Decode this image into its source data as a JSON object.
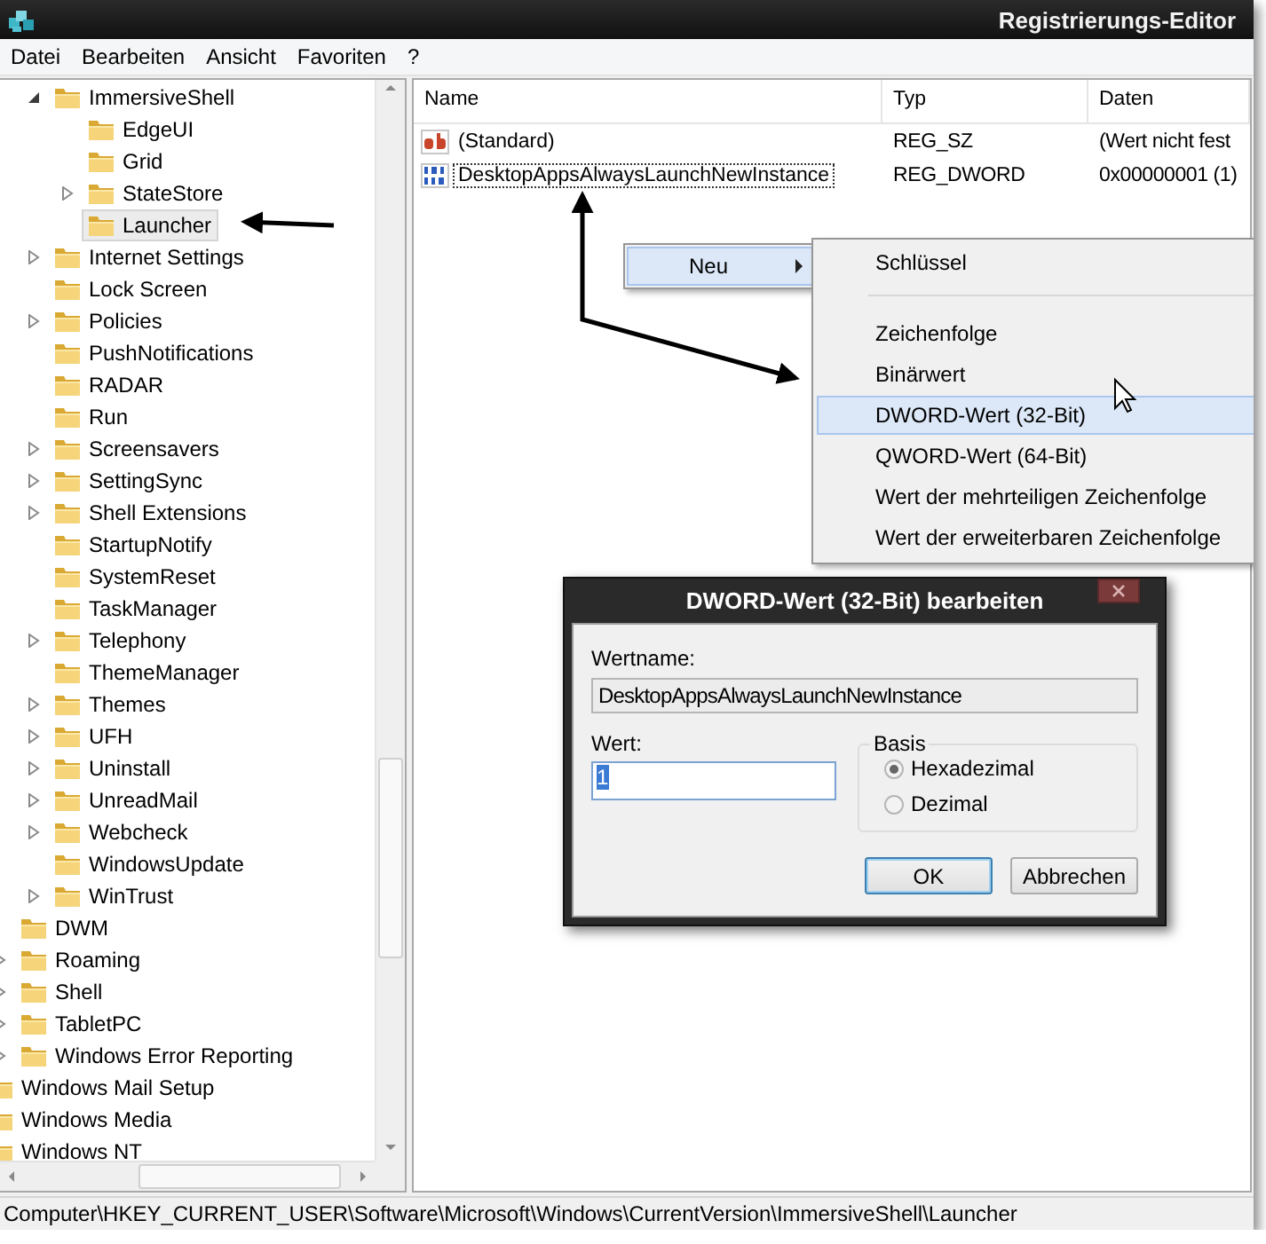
{
  "window": {
    "title": "Registrierungs-Editor"
  },
  "menu_bar": [
    "Datei",
    "Bearbeiten",
    "Ansicht",
    "Favoriten",
    "?"
  ],
  "tree": {
    "items": [
      {
        "children": [
          {
            "children": [
              {
                "label": "ImmersiveShell",
                "expanded": true,
                "selected": false,
                "children": [
                  {
                    "label": "EdgeUI",
                    "selected": false
                  },
                  {
                    "label": "Grid",
                    "selected": false
                  },
                  {
                    "label": "StateStore",
                    "expanded": false,
                    "selected": false
                  },
                  {
                    "label": "Launcher",
                    "selected": true
                  }
                ]
              },
              {
                "label": "Internet Settings",
                "expanded": false,
                "selected": false
              },
              {
                "label": "Lock Screen",
                "selected": false
              },
              {
                "label": "Policies",
                "expanded": false,
                "selected": false
              },
              {
                "label": "PushNotifications",
                "selected": false
              },
              {
                "label": "RADAR",
                "selected": false
              },
              {
                "label": "Run",
                "selected": false
              },
              {
                "label": "Screensavers",
                "expanded": false,
                "selected": false
              },
              {
                "label": "SettingSync",
                "expanded": false,
                "selected": false
              },
              {
                "label": "Shell Extensions",
                "expanded": false,
                "selected": false
              },
              {
                "label": "StartupNotify",
                "selected": false
              },
              {
                "label": "SystemReset",
                "selected": false
              },
              {
                "label": "TaskManager",
                "selected": false
              },
              {
                "label": "Telephony",
                "expanded": false,
                "selected": false
              },
              {
                "label": "ThemeManager",
                "selected": false
              },
              {
                "label": "Themes",
                "expanded": false,
                "selected": false
              },
              {
                "label": "UFH",
                "expanded": false,
                "selected": false
              },
              {
                "label": "Uninstall",
                "expanded": false,
                "selected": false
              },
              {
                "label": "UnreadMail",
                "expanded": false,
                "selected": false
              },
              {
                "label": "Webcheck",
                "expanded": false,
                "selected": false
              },
              {
                "label": "WindowsUpdate",
                "selected": false
              },
              {
                "label": "WinTrust",
                "expanded": false,
                "selected": false
              }
            ]
          },
          {
            "label": "DWM",
            "selected": false
          },
          {
            "label": "Roaming",
            "expanded": false,
            "selected": false
          },
          {
            "label": "Shell",
            "expanded": false,
            "selected": false
          },
          {
            "label": "TabletPC",
            "expanded": false,
            "selected": false
          },
          {
            "label": "Windows Error Reporting",
            "expanded": false,
            "selected": false
          }
        ]
      },
      {
        "label": "Windows Mail Setup",
        "selected": false
      },
      {
        "label": "Windows Media",
        "selected": false
      },
      {
        "label": "Windows NT",
        "selected": false
      }
    ]
  },
  "list": {
    "columns": [
      "Name",
      "Typ",
      "Daten"
    ],
    "rows": [
      {
        "kind": "string",
        "name": "(Standard)",
        "type": "REG_SZ",
        "data": "(Wert nicht fest",
        "focused": false
      },
      {
        "kind": "binary",
        "name": "DesktopAppsAlwaysLaunchNewInstance",
        "type": "REG_DWORD",
        "data": "0x00000001 (1)",
        "focused": true
      }
    ]
  },
  "context_menu": {
    "items": [
      {
        "label": "Neu",
        "selected": true
      }
    ]
  },
  "submenu": {
    "items": [
      {
        "label": "Schlüssel",
        "selected": false,
        "separator_after": true
      },
      {
        "label": "Zeichenfolge",
        "selected": false,
        "separator_after": false
      },
      {
        "label": "Binärwert",
        "selected": false,
        "separator_after": false
      },
      {
        "label": "DWORD-Wert (32-Bit)",
        "selected": true,
        "separator_after": false
      },
      {
        "label": "QWORD-Wert (64-Bit)",
        "selected": false,
        "separator_after": false
      },
      {
        "label": "Wert der mehrteiligen Zeichenfolge",
        "selected": false,
        "separator_after": false
      },
      {
        "label": "Wert der erweiterbaren Zeichenfolge",
        "selected": false,
        "separator_after": false
      }
    ]
  },
  "dialog": {
    "title": "DWORD-Wert (32-Bit) bearbeiten",
    "value_name_label": "Wertname:",
    "value_name": "DesktopAppsAlwaysLaunchNewInstance",
    "value_label": "Wert:",
    "value": "1",
    "base_label": "Basis",
    "base_options": [
      {
        "label": "Hexadezimal",
        "selected": true
      },
      {
        "label": "Dezimal",
        "selected": false
      }
    ],
    "buttons": [
      {
        "label": "OK",
        "default": true
      },
      {
        "label": "Abbrechen",
        "default": false
      }
    ]
  },
  "status_bar": "Computer\\HKEY_CURRENT_USER\\Software\\Microsoft\\Windows\\CurrentVersion\\ImmersiveShell\\Launcher"
}
